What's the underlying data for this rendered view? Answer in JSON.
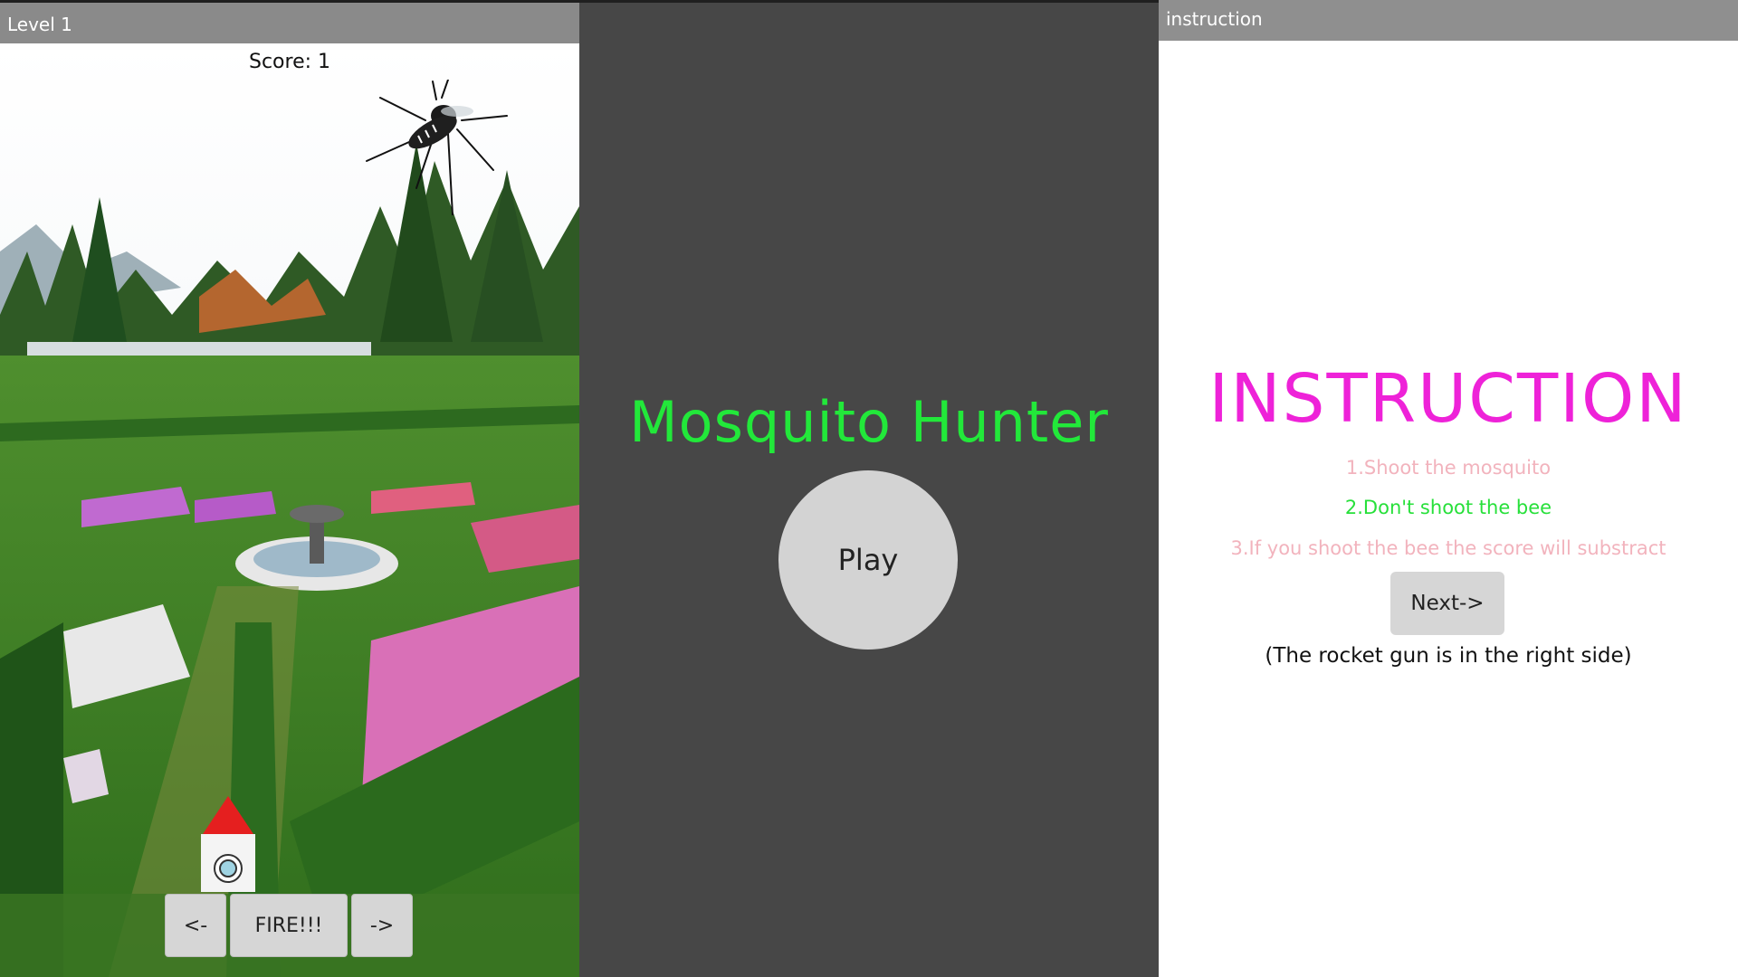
{
  "game_screen": {
    "title": "Level 1",
    "score_text": "Score: 1",
    "controls": {
      "left_label": "<-",
      "fire_label": "FIRE!!!",
      "right_label": "->"
    },
    "sprites": [
      "mosquito-icon",
      "rocket-gun-icon"
    ],
    "background": "garden-image"
  },
  "title_screen": {
    "game_title": "Mosquito Hunter",
    "play_label": "Play",
    "colors": {
      "background": "#474747",
      "title": "#22e83a",
      "play_button": "#d3d3d3"
    }
  },
  "instruction_screen": {
    "title": "instruction",
    "heading": "INSTRUCTION",
    "rules": [
      "1.Shoot the mosquito",
      "2.Don't shoot the bee",
      "3.If you shoot the bee the score will substract"
    ],
    "next_label": "Next->",
    "note": "(The rocket gun is in the right side)",
    "colors": {
      "heading": "#ee22d8",
      "rule_pink": "#f2b3bd",
      "rule_green": "#27e03a"
    }
  }
}
